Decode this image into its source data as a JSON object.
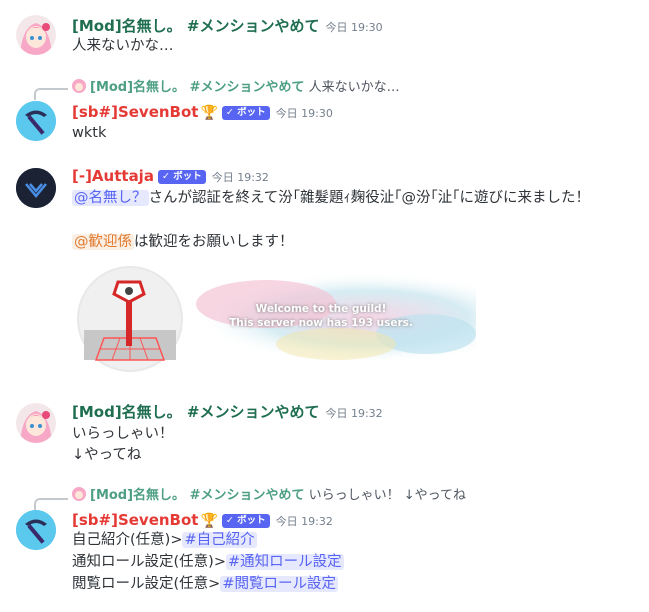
{
  "messages": {
    "m1": {
      "author": "[Mod]名無し。 #メンションやめて",
      "author_color": "#1f6e50",
      "timestamp": "今日 19:30",
      "text": "人来ないかな…"
    },
    "m2": {
      "reply_author": "[Mod]名無し。 #メンションやめて",
      "reply_text": "人来ないかな…",
      "author": "[sb#]SevenBot",
      "author_color": "#e53935",
      "badge": "✓ ボット",
      "timestamp": "今日 19:30",
      "text": "wktk"
    },
    "m3": {
      "author": "[-]Auttaja",
      "author_color": "#e53935",
      "badge": "✓ ボット",
      "timestamp": "今日 19:32",
      "line1_mention": "@名無し？",
      "line1_text": "さんが認証を終えて汾｢雜髮題ｨ麹役沚｢@汾｢沚｢に遊びに来ました！",
      "line2_mention": "@歓迎係",
      "line2_text": "は歓迎をお願いします！",
      "banner": {
        "title": "Welcome to the guild!",
        "subtitle": "This server now has 193 users."
      }
    },
    "m4": {
      "author": "[Mod]名無し。 #メンションやめて",
      "author_color": "#1f6e50",
      "timestamp": "今日 19:32",
      "line1": "いらっしゃい！",
      "line2": "↓やってね"
    },
    "m5": {
      "reply_author": "[Mod]名無し。 #メンションやめて",
      "reply_text": "いらっしゃい！ ↓やってね",
      "author": "[sb#]SevenBot",
      "author_color": "#e53935",
      "badge": "✓ ボット",
      "timestamp": "今日 19:32",
      "rows": [
        {
          "label": "自己紹介(任意)>",
          "channel": "#自己紹介"
        },
        {
          "label": "通知ロール設定(任意)>",
          "channel": "#通知ロール設定"
        },
        {
          "label": "閲覧ロール設定(任意>",
          "channel": "#閲覧ロール設定"
        }
      ]
    }
  },
  "icons": {
    "trophy": "trophy-icon",
    "bot_check": "check-icon"
  }
}
